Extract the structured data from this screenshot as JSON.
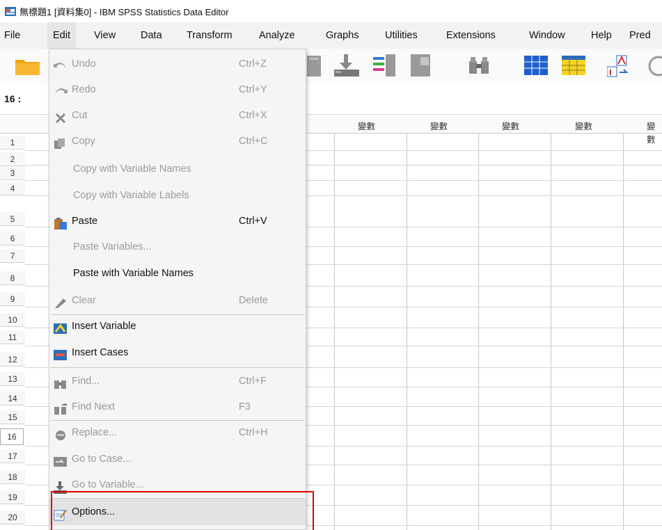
{
  "window": {
    "title": "無標題1 [資料集0] - IBM SPSS Statistics Data Editor"
  },
  "menubar": [
    {
      "label": "File"
    },
    {
      "label": "Edit"
    },
    {
      "label": "View"
    },
    {
      "label": "Data"
    },
    {
      "label": "Transform"
    },
    {
      "label": "Analyze"
    },
    {
      "label": "Graphs"
    },
    {
      "label": "Utilities"
    },
    {
      "label": "Extensions"
    },
    {
      "label": "Window"
    },
    {
      "label": "Help"
    },
    {
      "label": "Pred"
    }
  ],
  "cell_reference": "16 :",
  "grid": {
    "column_headers": [
      "變數",
      "變數",
      "變數",
      "變數",
      "變數",
      "變"
    ],
    "rows": [
      "1",
      "2",
      "3",
      "4",
      "5",
      "6",
      "7",
      "8",
      "9",
      "10",
      "11",
      "12",
      "13",
      "14",
      "15",
      "16",
      "17",
      "18",
      "19",
      "20"
    ],
    "selected_row": "16"
  },
  "edit_menu": [
    {
      "label": "Undo",
      "shortcut": "Ctrl+Z",
      "icon": "undo-icon"
    },
    {
      "label": "Redo",
      "shortcut": "Ctrl+Y",
      "icon": "redo-icon"
    },
    {
      "label": "Cut",
      "shortcut": "Ctrl+X",
      "icon": "cut-icon"
    },
    {
      "label": "Copy",
      "shortcut": "Ctrl+C",
      "icon": "copy-icon"
    },
    {
      "label": "Copy with Variable Names",
      "shortcut": ""
    },
    {
      "label": "Copy with Variable Labels",
      "shortcut": ""
    },
    {
      "label": "Paste",
      "shortcut": "Ctrl+V",
      "icon": "paste-icon"
    },
    {
      "label": "Paste Variables...",
      "shortcut": ""
    },
    {
      "label": "Paste with Variable Names",
      "shortcut": ""
    },
    {
      "label": "Clear",
      "shortcut": "Delete",
      "icon": "eraser-icon"
    },
    {
      "label": "Insert Variable",
      "shortcut": "",
      "icon": "insert-variable-icon"
    },
    {
      "label": "Insert Cases",
      "shortcut": "",
      "icon": "insert-cases-icon"
    },
    {
      "label": "Find...",
      "shortcut": "Ctrl+F",
      "icon": "find-icon"
    },
    {
      "label": "Find Next",
      "shortcut": "F3",
      "icon": "find-next-icon"
    },
    {
      "label": "Replace...",
      "shortcut": "Ctrl+H",
      "icon": "replace-icon"
    },
    {
      "label": "Go to Case...",
      "shortcut": "",
      "icon": "go-to-case-icon"
    },
    {
      "label": "Go to Variable...",
      "shortcut": "",
      "icon": "go-to-variable-icon"
    },
    {
      "label": "Options...",
      "shortcut": "",
      "icon": "options-icon"
    }
  ],
  "colors": {
    "highlight": "#e00000",
    "menubar": "#f2f2f2",
    "dropdown": "#f5f5f5"
  }
}
